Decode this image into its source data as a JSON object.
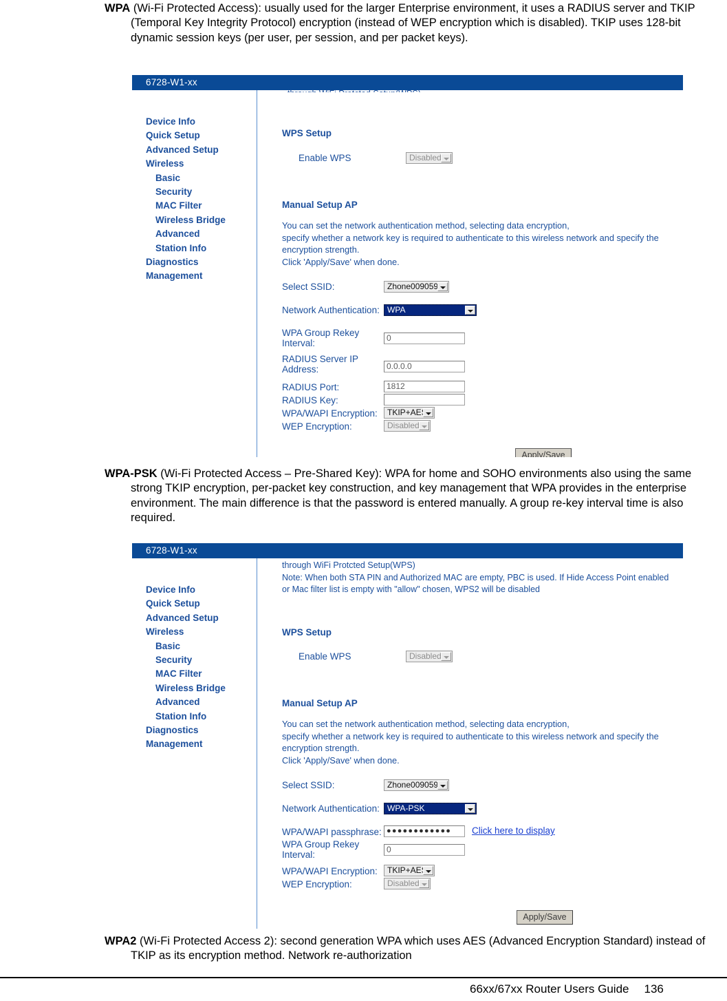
{
  "document": {
    "paragraphs": [
      {
        "term": "WPA",
        "text": " (Wi-Fi Protected Access): usually used for the larger Enterprise environment, it uses a RADIUS server and TKIP (Temporal Key Integrity Protocol) encryption (instead of WEP encryption which is disabled). TKIP uses 128-bit dynamic session keys (per user, per session, and per packet keys)."
      },
      {
        "term": "WPA-PSK",
        "text": " (Wi-Fi Protected Access – Pre-Shared Key): WPA for home and SOHO environments also using the same strong TKIP encryption, per-packet key construction, and key management that WPA provides in the enterprise environment. The main difference is that the password is entered manually. A group re-key interval time is also required."
      },
      {
        "term": "WPA2",
        "text": " (Wi-Fi Protected Access 2): second generation WPA which uses AES (Advanced Encryption Standard) instead of TKIP as its encryption method. Network re-authorization"
      }
    ]
  },
  "footer": {
    "guide": "66xx/67xx Router Users Guide",
    "page": "136"
  },
  "sidebar": {
    "items": [
      {
        "label": "Device Info",
        "sub": false
      },
      {
        "label": "Quick Setup",
        "sub": false
      },
      {
        "label": "Advanced Setup",
        "sub": false
      },
      {
        "label": "Wireless",
        "sub": false
      },
      {
        "label": "Basic",
        "sub": true
      },
      {
        "label": "Security",
        "sub": true
      },
      {
        "label": "MAC Filter",
        "sub": true
      },
      {
        "label": "Wireless Bridge",
        "sub": true
      },
      {
        "label": "Advanced",
        "sub": true
      },
      {
        "label": "Station Info",
        "sub": true
      },
      {
        "label": "Diagnostics",
        "sub": false
      },
      {
        "label": "Management",
        "sub": false
      }
    ]
  },
  "screenshot_wpa": {
    "titlebar": "6728-W1-xx",
    "clipped_top": "through WiFi Protcted Setup(WPS)",
    "wps_heading": "WPS Setup",
    "enable_wps_label": "Enable WPS",
    "enable_wps_value": "Disabled",
    "manual_heading": "Manual Setup AP",
    "manual_desc_lines": [
      "You can set the network authentication method, selecting data encryption,",
      "specify whether a network key is required to authenticate to this wireless network and specify the",
      "encryption strength.",
      "Click 'Apply/Save' when done."
    ],
    "select_ssid_label": "Select SSID:",
    "select_ssid_value": "Zhone009059",
    "network_auth_label": "Network Authentication:",
    "network_auth_value": "WPA",
    "rekey_label_line1": "WPA Group Rekey",
    "rekey_label_line2": "Interval:",
    "rekey_value": "0",
    "radius_ip_label_line1": "RADIUS Server IP",
    "radius_ip_label_line2": "Address:",
    "radius_ip_value": "0.0.0.0",
    "radius_port_label": "RADIUS Port:",
    "radius_port_value": "1812",
    "radius_key_label": "RADIUS Key:",
    "radius_key_value": "",
    "wpa_enc_label": "WPA/WAPI Encryption:",
    "wpa_enc_value": "TKIP+AES",
    "wep_enc_label": "WEP Encryption:",
    "wep_enc_value": "Disabled",
    "apply_save": "Apply/Save"
  },
  "screenshot_wpapsk": {
    "titlebar": "6728-W1-xx",
    "note_lines": [
      "through WiFi Protcted Setup(WPS)",
      "Note: When both STA PIN and Authorized MAC are empty, PBC is used. If Hide Access Point enabled",
      "or Mac filter list is empty with \"allow\" chosen, WPS2 will be disabled"
    ],
    "wps_heading": "WPS Setup",
    "enable_wps_label": "Enable WPS",
    "enable_wps_value": "Disabled",
    "manual_heading": "Manual Setup AP",
    "manual_desc_lines": [
      "You can set the network authentication method, selecting data encryption,",
      "specify whether a network key is required to authenticate to this wireless network and specify the",
      "encryption strength.",
      "Click 'Apply/Save' when done."
    ],
    "select_ssid_label": "Select SSID:",
    "select_ssid_value": "Zhone009059",
    "network_auth_label": "Network Authentication:",
    "network_auth_value": "WPA-PSK",
    "passphrase_label": "WPA/WAPI passphrase:",
    "passphrase_value": "●●●●●●●●●●●●",
    "passphrase_link": "Click here to display",
    "rekey_label_line1": "WPA Group Rekey",
    "rekey_label_line2": "Interval:",
    "rekey_value": "0",
    "wpa_enc_label": "WPA/WAPI Encryption:",
    "wpa_enc_value": "TKIP+AES",
    "wep_enc_label": "WEP Encryption:",
    "wep_enc_value": "Disabled",
    "apply_save": "Apply/Save"
  },
  "colors": {
    "titlebar_blue": "#0a4a96",
    "nav_blue": "#1c4f9c",
    "link_blue": "#1a3fd0",
    "select_highlight": "#06267e"
  }
}
